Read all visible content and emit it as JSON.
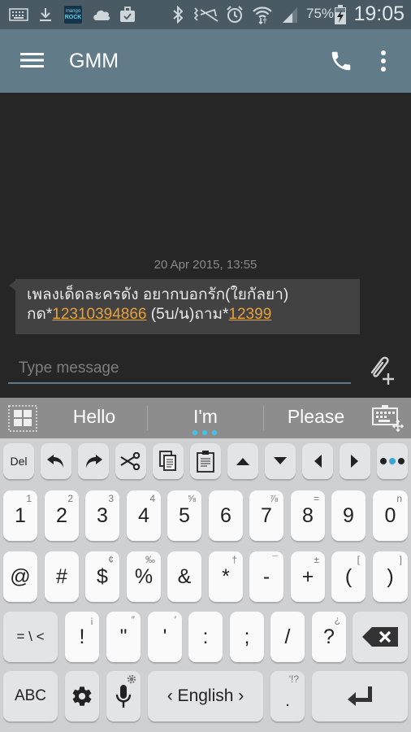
{
  "status_bar": {
    "left_icons": [
      "keyboard-icon",
      "download-icon",
      "mango-rock-app-icon",
      "cloud-icon",
      "briefcase-check-icon"
    ],
    "mango_label_top": "mango",
    "mango_label_bottom": "ROCK",
    "right_icons": [
      "bluetooth-icon",
      "mute-vibrate-icon",
      "alarm-icon",
      "wifi-icon",
      "signal-icon",
      "battery-charging-icon"
    ],
    "battery": "75%",
    "time": "19:05"
  },
  "app_bar": {
    "title": "GMM",
    "icons": [
      "menu-icon",
      "phone-icon",
      "more-vert-icon"
    ]
  },
  "conversation": {
    "timestamp": "20 Apr 2015, 13:55",
    "message": {
      "line1": "เพลงเด็ดละครดัง  อยากบอกรัก(ใยกัลยา)",
      "line2_prefix": "กด*",
      "link1": "12310394866",
      "line2_mid": " (5บ/น)ถาม*",
      "link2": "12399"
    }
  },
  "composer": {
    "placeholder": "Type message",
    "value": "",
    "attach_icon": "attach-add-icon"
  },
  "suggestions": {
    "words": [
      "Hello",
      "I'm",
      "Please"
    ],
    "left_icon": "grid-icon",
    "right_icon": "keyboard-move-icon"
  },
  "keyboard": {
    "toolbar": [
      {
        "label": "Del",
        "name": "del-key"
      },
      {
        "icon": "undo-icon",
        "name": "undo-key"
      },
      {
        "icon": "redo-icon",
        "name": "redo-key"
      },
      {
        "icon": "cut-icon",
        "name": "cut-key"
      },
      {
        "icon": "copy-icon",
        "name": "copy-key"
      },
      {
        "icon": "paste-icon",
        "name": "paste-key"
      },
      {
        "icon": "arrow-up-icon",
        "name": "up-key"
      },
      {
        "icon": "arrow-down-icon",
        "name": "down-key"
      },
      {
        "icon": "arrow-left-icon",
        "name": "left-key"
      },
      {
        "icon": "arrow-right-icon",
        "name": "right-key"
      },
      {
        "icon": "more-dots-icon",
        "name": "more-key"
      }
    ],
    "row1": [
      {
        "main": "1",
        "sup": "1"
      },
      {
        "main": "2",
        "sup": "2"
      },
      {
        "main": "3",
        "sup": "3"
      },
      {
        "main": "4",
        "sup": "4"
      },
      {
        "main": "5",
        "sup": "⅝"
      },
      {
        "main": "6",
        "sup": ""
      },
      {
        "main": "7",
        "sup": "⅞"
      },
      {
        "main": "8",
        "sup": "="
      },
      {
        "main": "9",
        "sup": ""
      },
      {
        "main": "0",
        "sup": "n"
      }
    ],
    "row2": [
      {
        "main": "@",
        "sup": ""
      },
      {
        "main": "#",
        "sup": ""
      },
      {
        "main": "$",
        "sup": "¢"
      },
      {
        "main": "%",
        "sup": "‰"
      },
      {
        "main": "&",
        "sup": ""
      },
      {
        "main": "*",
        "sup": "†"
      },
      {
        "main": "-",
        "sup": "¯"
      },
      {
        "main": "+",
        "sup": "±"
      },
      {
        "main": "(",
        "sup": "["
      },
      {
        "main": ")",
        "sup": "]"
      }
    ],
    "row3": [
      {
        "main": "= \\ <",
        "sup": ""
      },
      {
        "main": "!",
        "sup": "¡"
      },
      {
        "main": "\"",
        "sup": "″"
      },
      {
        "main": "'",
        "sup": "′"
      },
      {
        "main": ":",
        "sup": ""
      },
      {
        "main": ";",
        "sup": ""
      },
      {
        "main": "/",
        "sup": ""
      },
      {
        "main": "?",
        "sup": "¿"
      }
    ],
    "row4": {
      "abc": "ABC",
      "language": "‹ English ›",
      "period": ".",
      "period_sup": "'!?"
    }
  }
}
